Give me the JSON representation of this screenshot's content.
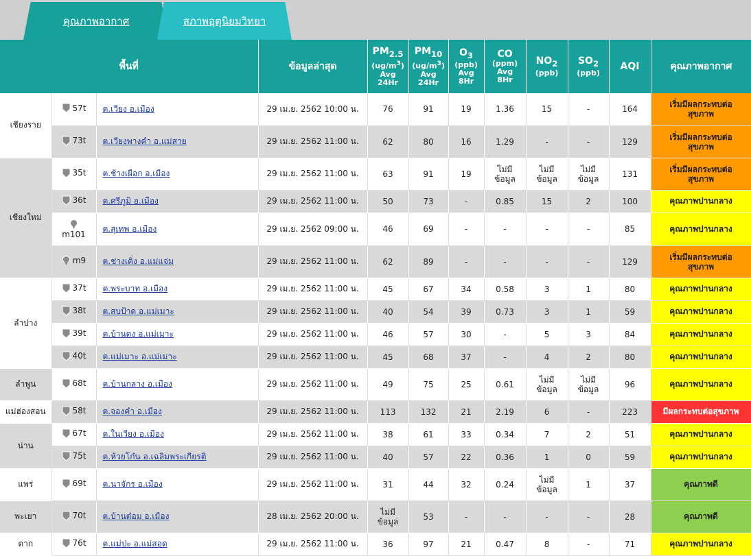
{
  "tabs": [
    {
      "label": "คุณภาพอากาศ"
    },
    {
      "label": "สภาพอุตุนิยมวิทยา"
    }
  ],
  "headers": {
    "area": "พื้นที่",
    "latest": "ข้อมูลล่าสุด",
    "pm25_main": "PM",
    "pm25_sub": "2.5",
    "pm25_unit": "(ug/m",
    "pm25_sup": "3",
    "pm25_unit_close": ")",
    "pm25_avg": "Avg",
    "pm25_hr": "24Hr",
    "pm10_main": "PM",
    "pm10_sub": "10",
    "pm10_unit": "(ug/m",
    "pm10_sup": "3",
    "pm10_unit_close": ")",
    "pm10_avg": "Avg",
    "pm10_hr": "24Hr",
    "o3_main": "O",
    "o3_sub": "3",
    "o3_unit": "(ppb)",
    "o3_avg": "Avg",
    "o3_hr": "8Hr",
    "co_main": "CO",
    "co_unit": "(ppm)",
    "co_avg": "Avg",
    "co_hr": "8Hr",
    "no2_main": "NO",
    "no2_sub": "2",
    "no2_unit": "(ppb)",
    "so2_main": "SO",
    "so2_sub": "2",
    "so2_unit": "(ppb)",
    "aqi": "AQI",
    "quality": "คุณภาพอากาศ"
  },
  "colors": {
    "orange": "#ff9900",
    "yellow": "#ffff00",
    "red": "#ff3333",
    "green": "#8fcf4f",
    "teal": "#17a19a"
  },
  "provinces": [
    {
      "name": "เชียงราย",
      "rows": 2,
      "gray": false
    },
    {
      "name": "เชียงใหม่",
      "rows": 4,
      "gray": true
    },
    {
      "name": "ลำปาง",
      "rows": 4,
      "gray": false
    },
    {
      "name": "ลำพูน",
      "rows": 1,
      "gray": true
    },
    {
      "name": "แม่ฮ่องสอน",
      "rows": 1,
      "gray": false
    },
    {
      "name": "น่าน",
      "rows": 2,
      "gray": true
    },
    {
      "name": "แพร่",
      "rows": 1,
      "gray": false
    },
    {
      "name": "พะเยา",
      "rows": 1,
      "gray": true
    },
    {
      "name": "ตาก",
      "rows": 1,
      "gray": false
    }
  ],
  "rows": [
    {
      "station": "57t",
      "stack": false,
      "area": "ต.เวียง อ.เมือง",
      "time": "29 เม.ย. 2562 10:00 น.",
      "pm25": "76",
      "pm10": "91",
      "o3": "19",
      "co": "1.36",
      "no2": "15",
      "so2": "-",
      "aqi": "164",
      "q1": "เริ่มมีผลกระทบต่อ",
      "q2": "สุขภาพ",
      "qc": "orange",
      "bg": "w",
      "h": 47
    },
    {
      "station": "73t",
      "stack": false,
      "area": "ต.เวียงพางคำ อ.แม่สาย",
      "time": "29 เม.ย. 2562 11:00 น.",
      "pm25": "62",
      "pm10": "80",
      "o3": "16",
      "co": "1.29",
      "no2": "-",
      "so2": "-",
      "aqi": "129",
      "q1": "เริ่มมีผลกระทบต่อ",
      "q2": "สุขภาพ",
      "qc": "orange",
      "bg": "g",
      "h": 47
    },
    {
      "station": "35t",
      "stack": false,
      "area": "ต.ช้างเผือก อ.เมือง",
      "time": "29 เม.ย. 2562 11:00 น.",
      "pm25": "63",
      "pm10": "91",
      "o3": "19",
      "co": "ไม่มี|ข้อมูล",
      "no2": "ไม่มี|ข้อมูล",
      "so2": "ไม่มี|ข้อมูล",
      "aqi": "131",
      "q1": "เริ่มมีผลกระทบต่อ",
      "q2": "สุขภาพ",
      "qc": "orange",
      "bg": "w",
      "h": 47
    },
    {
      "station": "36t",
      "stack": false,
      "area": "ต.ศรีภูมิ อ.เมือง",
      "time": "29 เม.ย. 2562 11:00 น.",
      "pm25": "50",
      "pm10": "73",
      "o3": "-",
      "co": "0.85",
      "no2": "15",
      "so2": "2",
      "aqi": "100",
      "q1": "คุณภาพปานกลาง",
      "q2": "",
      "qc": "yellow",
      "bg": "g",
      "h": 33
    },
    {
      "station": "m101",
      "stack": true,
      "area": "ต.สุเทพ อ.เมือง",
      "time": "29 เม.ย. 2562 09:00 น.",
      "pm25": "46",
      "pm10": "69",
      "o3": "-",
      "co": "-",
      "no2": "-",
      "so2": "-",
      "aqi": "85",
      "q1": "คุณภาพปานกลาง",
      "q2": "",
      "qc": "yellow",
      "bg": "w",
      "h": 48
    },
    {
      "station": "m9",
      "stack": false,
      "area": "ต.ช่างเคิ่ง อ.แม่แจ่ม",
      "time": "29 เม.ย. 2562 11:00 น.",
      "pm25": "62",
      "pm10": "89",
      "o3": "-",
      "co": "-",
      "no2": "-",
      "so2": "-",
      "aqi": "129",
      "q1": "เริ่มมีผลกระทบต่อ",
      "q2": "สุขภาพ",
      "qc": "orange",
      "bg": "g",
      "h": 47
    },
    {
      "station": "37t",
      "stack": false,
      "area": "ต.พระบาท อ.เมือง",
      "time": "29 เม.ย. 2562 11:00 น.",
      "pm25": "45",
      "pm10": "67",
      "o3": "34",
      "co": "0.58",
      "no2": "3",
      "so2": "1",
      "aqi": "80",
      "q1": "คุณภาพปานกลาง",
      "q2": "",
      "qc": "yellow",
      "bg": "w",
      "h": 33
    },
    {
      "station": "38t",
      "stack": false,
      "area": "ต.สบป้าด อ.แม่เมาะ",
      "time": "29 เม.ย. 2562 11:00 น.",
      "pm25": "40",
      "pm10": "54",
      "o3": "39",
      "co": "0.73",
      "no2": "3",
      "so2": "1",
      "aqi": "59",
      "q1": "คุณภาพปานกลาง",
      "q2": "",
      "qc": "yellow",
      "bg": "g",
      "h": 33
    },
    {
      "station": "39t",
      "stack": false,
      "area": "ต.บ้านดง อ.แม่เมาะ",
      "time": "29 เม.ย. 2562 11:00 น.",
      "pm25": "46",
      "pm10": "57",
      "o3": "30",
      "co": "-",
      "no2": "5",
      "so2": "3",
      "aqi": "84",
      "q1": "คุณภาพปานกลาง",
      "q2": "",
      "qc": "yellow",
      "bg": "w",
      "h": 33
    },
    {
      "station": "40t",
      "stack": false,
      "area": "ต.แม่เมาะ อ.แม่เมาะ",
      "time": "29 เม.ย. 2562 11:00 น.",
      "pm25": "45",
      "pm10": "68",
      "o3": "37",
      "co": "-",
      "no2": "4",
      "so2": "2",
      "aqi": "80",
      "q1": "คุณภาพปานกลาง",
      "q2": "",
      "qc": "yellow",
      "bg": "g",
      "h": 33
    },
    {
      "station": "68t",
      "stack": false,
      "area": "ต.บ้านกลาง อ.เมือง",
      "time": "29 เม.ย. 2562 11:00 น.",
      "pm25": "49",
      "pm10": "75",
      "o3": "25",
      "co": "0.61",
      "no2": "ไม่มี|ข้อมูล",
      "so2": "ไม่มี|ข้อมูล",
      "aqi": "96",
      "q1": "คุณภาพปานกลาง",
      "q2": "",
      "qc": "yellow",
      "bg": "w",
      "h": 47
    },
    {
      "station": "58t",
      "stack": false,
      "area": "ต.จองคำ อ.เมือง",
      "time": "29 เม.ย. 2562 11:00 น.",
      "pm25": "113",
      "pm10": "132",
      "o3": "21",
      "co": "2.19",
      "no2": "6",
      "so2": "-",
      "aqi": "223",
      "q1": "มีผลกระทบต่อสุขภาพ",
      "q2": "",
      "qc": "red",
      "bg": "g",
      "h": 33
    },
    {
      "station": "67t",
      "stack": false,
      "area": "ต.ในเวียง อ.เมือง",
      "time": "29 เม.ย. 2562 11:00 น.",
      "pm25": "38",
      "pm10": "61",
      "o3": "33",
      "co": "0.34",
      "no2": "7",
      "so2": "2",
      "aqi": "51",
      "q1": "คุณภาพปานกลาง",
      "q2": "",
      "qc": "yellow",
      "bg": "w",
      "h": 33
    },
    {
      "station": "75t",
      "stack": false,
      "area": "ต.ห้วยโก๋น อ.เฉลิมพระเกียรติ",
      "time": "29 เม.ย. 2562 11:00 น.",
      "pm25": "40",
      "pm10": "57",
      "o3": "22",
      "co": "0.36",
      "no2": "1",
      "so2": "0",
      "aqi": "59",
      "q1": "คุณภาพปานกลาง",
      "q2": "",
      "qc": "yellow",
      "bg": "g",
      "h": 33
    },
    {
      "station": "69t",
      "stack": false,
      "area": "ต.นาจักร อ.เมือง",
      "time": "29 เม.ย. 2562 11:00 น.",
      "pm25": "31",
      "pm10": "44",
      "o3": "32",
      "co": "0.24",
      "no2": "ไม่มี|ข้อมูล",
      "so2": "1",
      "aqi": "37",
      "q1": "คุณภาพดี",
      "q2": "",
      "qc": "green",
      "bg": "w",
      "h": 47
    },
    {
      "station": "70t",
      "stack": false,
      "area": "ต.บ้านต๋อม อ.เมือง",
      "time": "28 เม.ย. 2562 20:00 น.",
      "pm25": "ไม่มี|ข้อมูล",
      "pm10": "53",
      "o3": "-",
      "co": "-",
      "no2": "-",
      "so2": "-",
      "aqi": "28",
      "q1": "คุณภาพดี",
      "q2": "",
      "qc": "green",
      "bg": "g",
      "h": 47
    },
    {
      "station": "76t",
      "stack": false,
      "area": "ต.แม่ปะ อ.แม่สอด",
      "time": "29 เม.ย. 2562 11:00 น.",
      "pm25": "36",
      "pm10": "97",
      "o3": "21",
      "co": "0.47",
      "no2": "8",
      "so2": "-",
      "aqi": "71",
      "q1": "คุณภาพปานกลาง",
      "q2": "",
      "qc": "yellow",
      "bg": "w",
      "h": 33
    }
  ]
}
